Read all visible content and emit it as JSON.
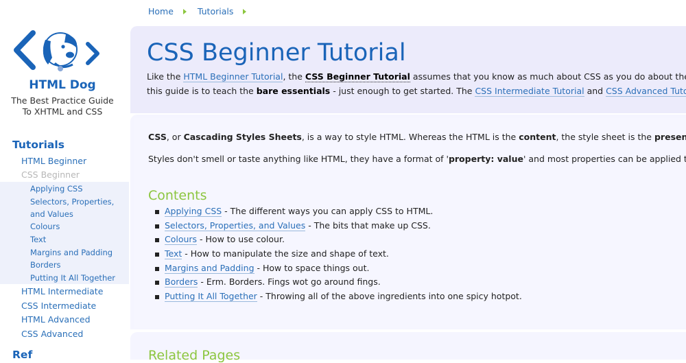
{
  "breadcrumb": [
    "Home",
    "Tutorials"
  ],
  "site": {
    "name": "HTML Dog",
    "tagline_line1": "The Best Practice Guide",
    "tagline_line2": "To XHTML and CSS"
  },
  "nav": {
    "heading": "Tutorials",
    "top_items": [
      "HTML Beginner",
      "CSS Beginner",
      "HTML Intermediate",
      "CSS Intermediate",
      "HTML Advanced",
      "CSS Advanced"
    ],
    "current_item": "CSS Beginner",
    "sub_items": [
      "Applying CSS",
      "Selectors, Properties,",
      "and Values",
      "Colours",
      "Text",
      "Margins and Padding",
      "Borders",
      "Putting It All Together"
    ],
    "next_heading_partial": "Ref"
  },
  "header": {
    "title": "CSS Beginner Tutorial",
    "intro_line1_a": "Like the ",
    "intro_link1": "HTML Beginner Tutorial",
    "intro_line1_b": ", the ",
    "intro_bold1": "CSS Beginner Tutorial",
    "intro_line1_c": " assumes that you know as much about CSS as you do about the c",
    "intro_line2_a": "this guide is to teach the ",
    "intro_bold2": "bare essentials",
    "intro_line2_b": " - just enough to get started. The ",
    "intro_link2": "CSS Intermediate Tutorial",
    "intro_line2_c": " and ",
    "intro_link3": "CSS Advanced Tutor"
  },
  "body": {
    "p1_b1": "CSS",
    "p1_t1": ", or ",
    "p1_b2": "Cascading Styles Sheets",
    "p1_t2": ", is a way to style HTML. Whereas the HTML is the ",
    "p1_b3": "content",
    "p1_t3": ", the style sheet is the ",
    "p1_b4": "presenta",
    "p2_t1": "Styles don't smell or taste anything like HTML, they have a format of '",
    "p2_b1": "property: value",
    "p2_t2": "' and most properties can be applied to m",
    "contents_heading": "Contents",
    "contents": [
      {
        "link": "Applying CSS",
        "desc": " - The different ways you can apply CSS to HTML."
      },
      {
        "link": "Selectors, Properties, and Values",
        "desc": " - The bits that make up CSS."
      },
      {
        "link": "Colours",
        "desc": " - How to use colour."
      },
      {
        "link": "Text",
        "desc": " - How to manipulate the size and shape of text."
      },
      {
        "link": "Margins and Padding",
        "desc": " - How to space things out."
      },
      {
        "link": "Borders",
        "desc": " - Erm. Borders. Fings wot go around fings."
      },
      {
        "link": "Putting It All Together",
        "desc": " - Throwing all of the above ingredients into one spicy hotpot."
      }
    ],
    "related_heading": "Related Pages"
  },
  "colors": {
    "brand_blue": "#1a64b8",
    "accent_green": "#8cc63f",
    "panel_lavender": "#ecebfb",
    "link": "#2a6fb8"
  }
}
